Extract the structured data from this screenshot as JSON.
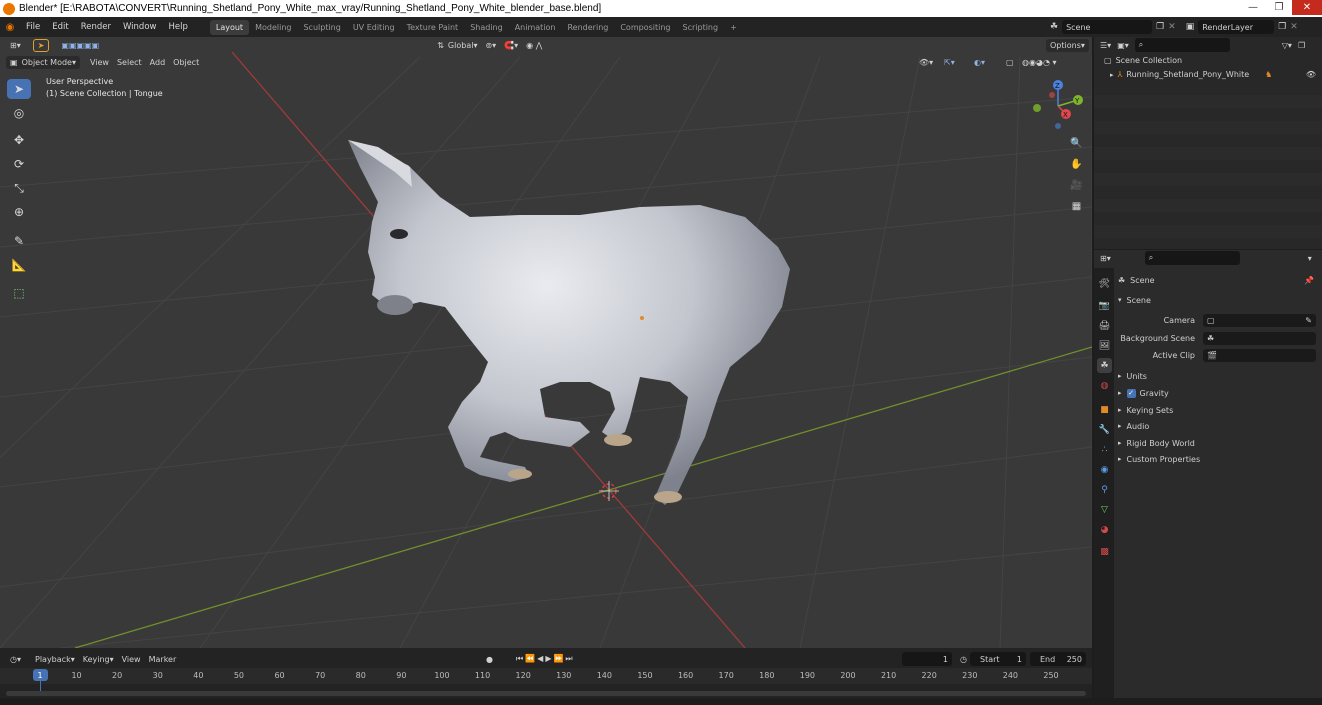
{
  "window": {
    "title": "Blender* [E:\\RABOTA\\CONVERT\\Running_Shetland_Pony_White_max_vray/Running_Shetland_Pony_White_blender_base.blend]"
  },
  "menu": [
    "File",
    "Edit",
    "Render",
    "Window",
    "Help"
  ],
  "workspaces": [
    "Layout",
    "Modeling",
    "Sculpting",
    "UV Editing",
    "Texture Paint",
    "Shading",
    "Animation",
    "Rendering",
    "Compositing",
    "Scripting"
  ],
  "active_workspace": "Layout",
  "scene_field": "Scene",
  "renderlayer_field": "RenderLayer",
  "viewport": {
    "orientation": "Global",
    "options_label": "Options",
    "mode": "Object Mode",
    "header_menus": [
      "View",
      "Select",
      "Add",
      "Object"
    ],
    "overlay_line1": "User Perspective",
    "overlay_line2": "(1) Scene Collection | Tongue",
    "gizmo_axes": [
      "Z",
      "Y",
      "X"
    ],
    "axis_colors": {
      "x": "#e0474e",
      "y": "#7fb52c",
      "z": "#4a83e0"
    }
  },
  "outliner": {
    "root": "Scene Collection",
    "item": "Running_Shetland_Pony_White"
  },
  "properties": {
    "context": "Scene",
    "panel": "Scene",
    "camera_label": "Camera",
    "background_label": "Background Scene",
    "clip_label": "Active Clip",
    "sections": [
      "Units",
      "Gravity",
      "Keying Sets",
      "Audio",
      "Rigid Body World",
      "Custom Properties"
    ],
    "gravity_checked": true
  },
  "timeline": {
    "menus": [
      "Playback",
      "Keying",
      "View",
      "Marker"
    ],
    "current_frame": "1",
    "start_label": "Start",
    "start": "1",
    "end_label": "End",
    "end": "250",
    "ticks": [
      "1",
      "10",
      "20",
      "30",
      "40",
      "50",
      "60",
      "70",
      "80",
      "90",
      "100",
      "110",
      "120",
      "130",
      "140",
      "150",
      "160",
      "170",
      "180",
      "190",
      "200",
      "210",
      "220",
      "230",
      "240",
      "250"
    ]
  }
}
